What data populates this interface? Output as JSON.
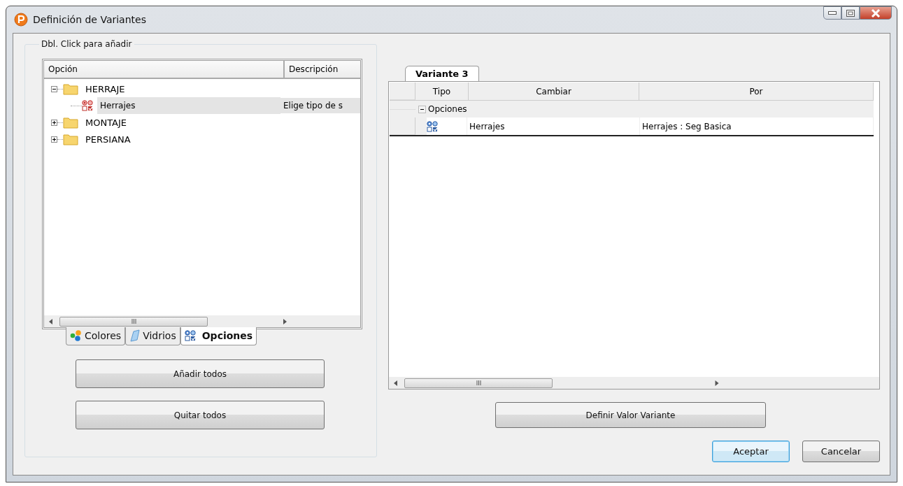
{
  "window": {
    "title": "Definición de Variantes"
  },
  "left_panel": {
    "group_title": "Dbl. Click para añadir",
    "tree": {
      "columns": [
        "Opción",
        "Descripción"
      ],
      "items": [
        {
          "label": "HERRAJE",
          "kind": "folder",
          "expanded": true,
          "selected": false,
          "children": [
            {
              "label": "Herrajes",
              "description": "Elige tipo de s",
              "kind": "option",
              "selected": true
            }
          ]
        },
        {
          "label": "MONTAJE",
          "kind": "folder",
          "expanded": false,
          "selected": false
        },
        {
          "label": "PERSIANA",
          "kind": "folder",
          "expanded": false,
          "selected": false
        }
      ]
    },
    "tabs": [
      {
        "label": "Colores",
        "selected": false
      },
      {
        "label": "Vidrios",
        "selected": false
      },
      {
        "label": "Opciones",
        "selected": true
      }
    ],
    "buttons": [
      "Añadir todos",
      "Quitar todos"
    ]
  },
  "right_panel": {
    "tabs": [
      {
        "label": "Variante 3",
        "selected": true
      }
    ],
    "grid": {
      "columns": [
        "Tipo",
        "Cambiar",
        "Por"
      ],
      "groups": [
        {
          "label": "Opciones",
          "expanded": true,
          "rows": [
            {
              "cambiar": "Herrajes",
              "por": "Herrajes : Seg Basica"
            }
          ]
        }
      ]
    },
    "define_button": "Definir Valor Variante"
  },
  "dialog_buttons": [
    {
      "label": "Aceptar",
      "default": true
    },
    {
      "label": "Cancelar",
      "default": false
    }
  ]
}
